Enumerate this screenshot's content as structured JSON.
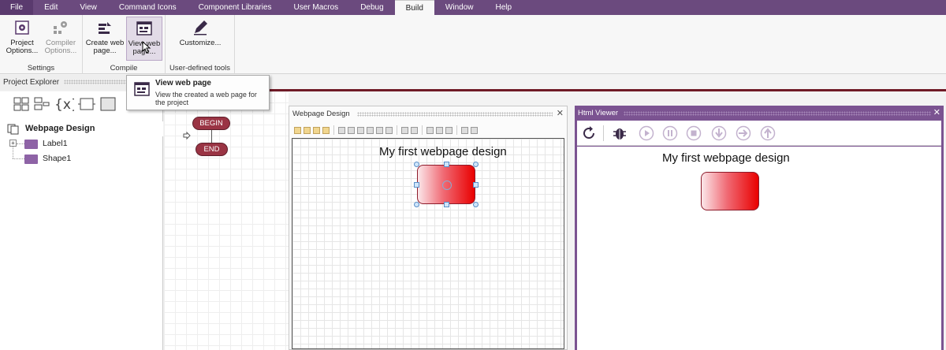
{
  "menubar": {
    "items": [
      "File",
      "Edit",
      "View",
      "Command Icons",
      "Component Libraries",
      "User Macros",
      "Debug",
      "Build",
      "Window",
      "Help"
    ],
    "active": "Build"
  },
  "ribbon": {
    "settings": {
      "label": "Settings",
      "project_options": "Project\nOptions...",
      "compiler_options": "Compiler\nOptions..."
    },
    "compile": {
      "label": "Compile",
      "create_web_page": "Create web\npage...",
      "view_web_page": "View web\npage..."
    },
    "user_tools": {
      "label": "User-defined tools",
      "customize": "Customize..."
    }
  },
  "tooltip": {
    "title": "View web page",
    "body": "View the created a web page for the project"
  },
  "project_explorer": {
    "title": "Project Explorer",
    "tree": {
      "root": "Webpage Design",
      "children": [
        "Label1",
        "Shape1"
      ]
    }
  },
  "flowchart": {
    "begin": "BEGIN",
    "end": "END"
  },
  "webpage_design": {
    "title": "Webpage Design",
    "canvas_label": "My first webpage design"
  },
  "html_viewer": {
    "title": "Html Viewer",
    "page_text": "My first webpage design"
  },
  "colors": {
    "accent": "#6b4a7e",
    "viewer_frame": "#7b5391",
    "flow_pill": "#9a3444",
    "shape_red": "#e90000"
  }
}
